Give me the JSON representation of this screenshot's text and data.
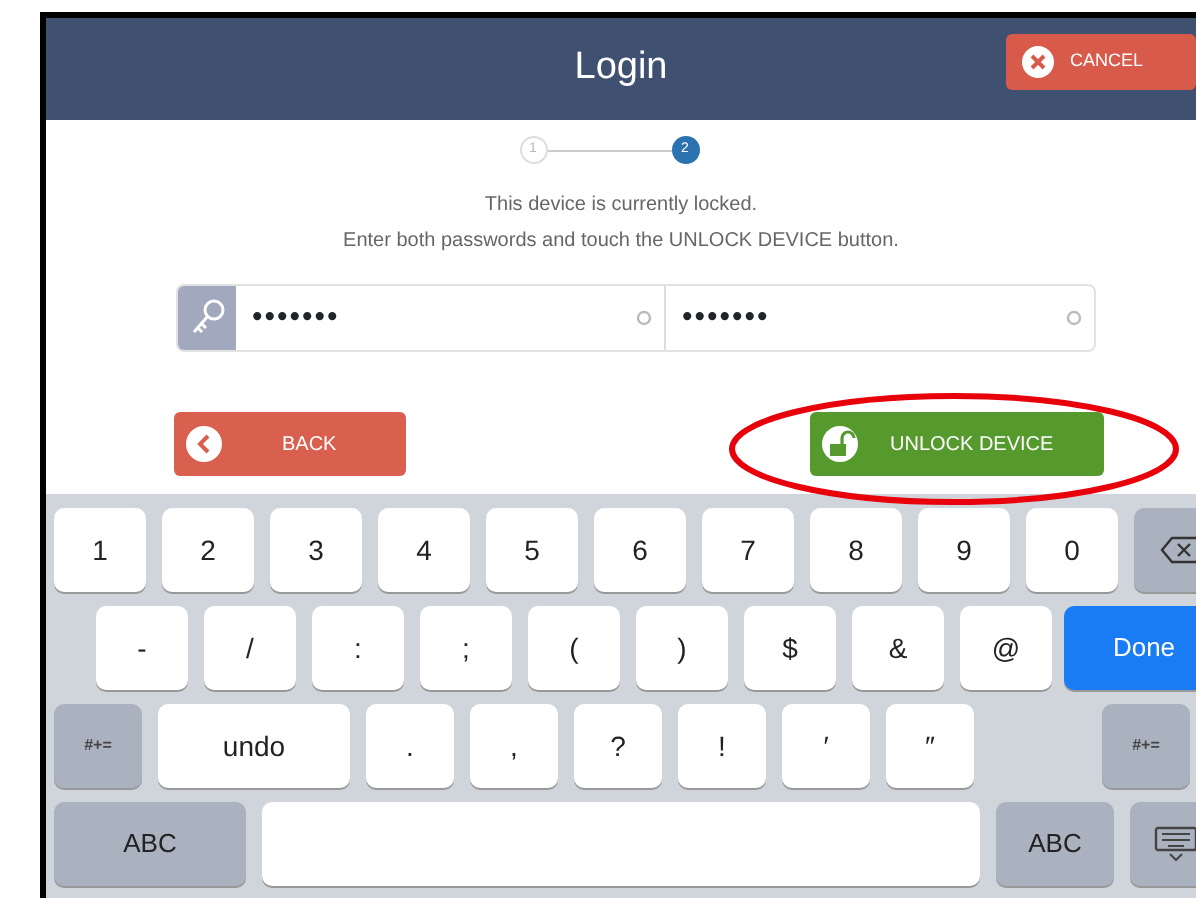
{
  "header": {
    "title": "Login",
    "cancel_button": "CANCEL"
  },
  "stepper": [
    {
      "label": "1",
      "selected": false
    },
    {
      "label": "2",
      "selected": true
    }
  ],
  "message": [
    "This device is currently locked.",
    "Enter both passwords and touch the UNLOCK DEVICE button."
  ],
  "password_fields": [
    {
      "value": "•••••••"
    },
    {
      "value": "•••••••"
    }
  ],
  "buttons": [
    {
      "kind": "back",
      "label": "BACK"
    },
    {
      "kind": "unlock",
      "label": "UNLOCK DEVICE"
    }
  ],
  "annotations": [
    {
      "kind": "ellipse"
    }
  ],
  "keyboard": [
    [
      {
        "kind": "char",
        "label": "1"
      },
      {
        "kind": "char",
        "label": "2"
      },
      {
        "kind": "char",
        "label": "3"
      },
      {
        "kind": "char",
        "label": "4"
      },
      {
        "kind": "char",
        "label": "5"
      },
      {
        "kind": "char",
        "label": "6"
      },
      {
        "kind": "char",
        "label": "7"
      },
      {
        "kind": "char",
        "label": "8"
      },
      {
        "kind": "char",
        "label": "9"
      },
      {
        "kind": "char",
        "label": "0"
      },
      {
        "kind": "backspace"
      }
    ],
    [
      {
        "kind": "char",
        "label": "-"
      },
      {
        "kind": "char",
        "label": "/"
      },
      {
        "kind": "char",
        "label": ":"
      },
      {
        "kind": "char",
        "label": ";"
      },
      {
        "kind": "char",
        "label": "("
      },
      {
        "kind": "char",
        "label": ")"
      },
      {
        "kind": "char",
        "label": "$"
      },
      {
        "kind": "char",
        "label": "&"
      },
      {
        "kind": "char",
        "label": "@"
      },
      {
        "kind": "done",
        "label": "Done"
      }
    ],
    [
      {
        "kind": "function",
        "label": "#+="
      },
      {
        "kind": "wide",
        "label": "undo"
      },
      {
        "kind": "char",
        "label": "."
      },
      {
        "kind": "char",
        "label": ","
      },
      {
        "kind": "char",
        "label": "?"
      },
      {
        "kind": "char",
        "label": "!"
      },
      {
        "kind": "char",
        "label": "′"
      },
      {
        "kind": "char",
        "label": "″"
      },
      {
        "kind": "gap"
      },
      {
        "kind": "function",
        "label": "#+="
      }
    ],
    [
      {
        "kind": "abc",
        "label": "ABC"
      },
      {
        "kind": "space"
      },
      {
        "kind": "abc-small",
        "label": "ABC"
      },
      {
        "kind": "dismiss"
      }
    ]
  ]
}
